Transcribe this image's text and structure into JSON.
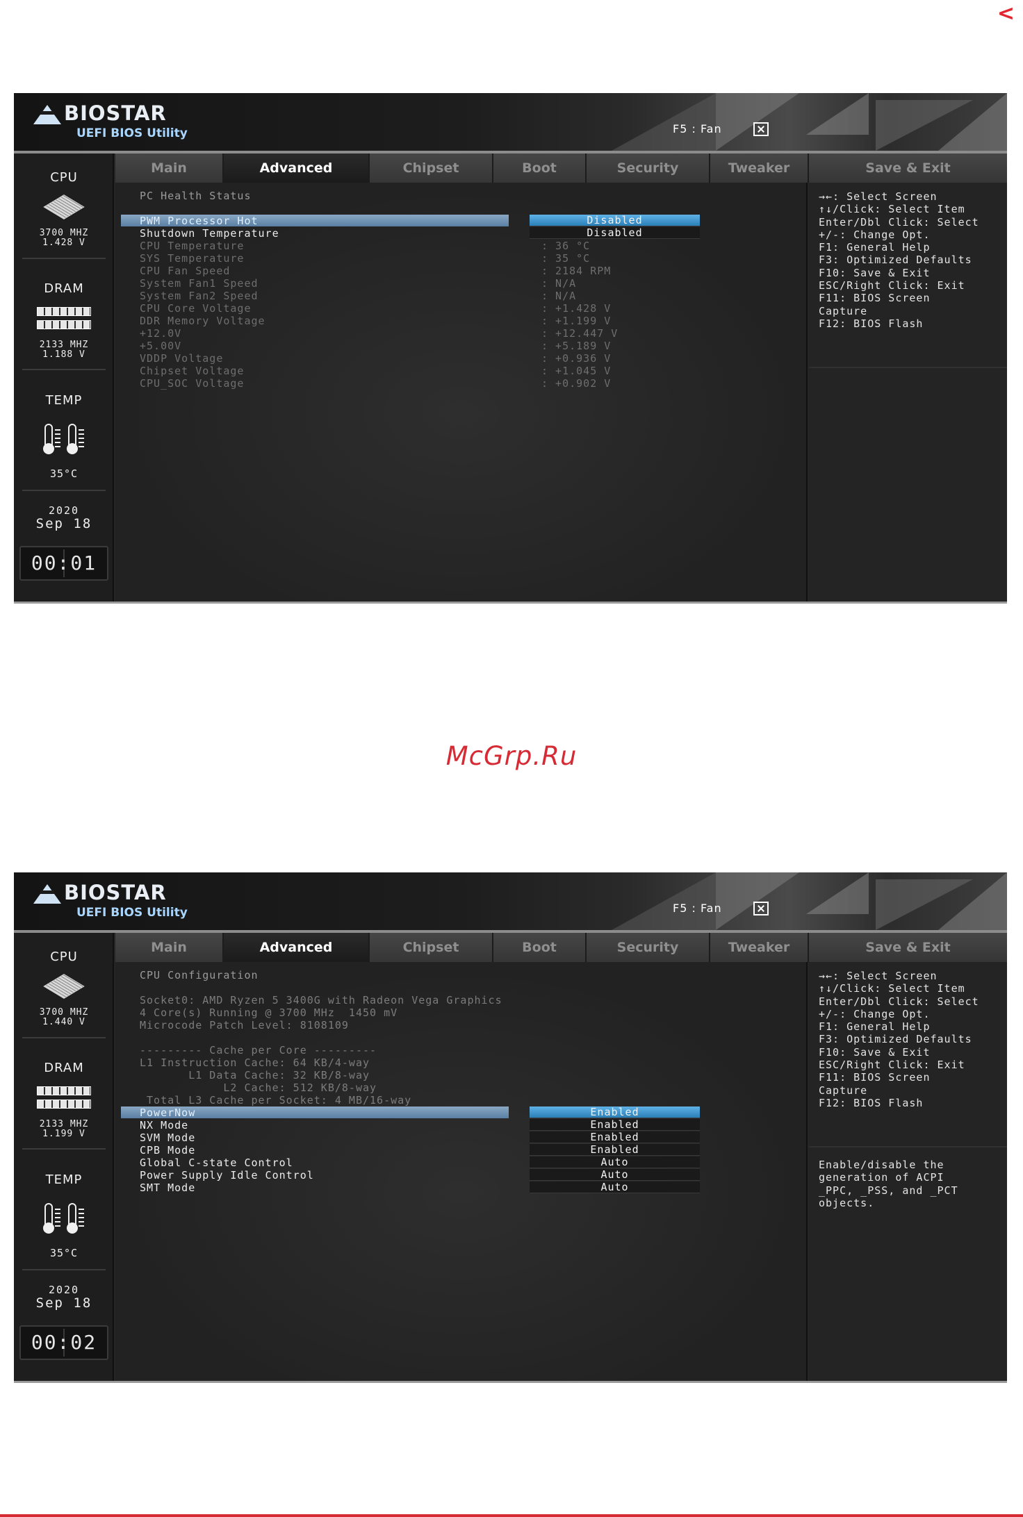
{
  "page": {
    "corner_arrow": "<",
    "watermark": "McGrp.Ru"
  },
  "common": {
    "logo_text": "BIOSTAR",
    "logo_sub": "UEFI BIOS Utility",
    "f5_fan": "F5 : Fan",
    "sidebar_titles": {
      "cpu": "CPU",
      "dram": "DRAM",
      "temp": "TEMP"
    },
    "tabs": [
      "Main",
      "Advanced",
      "Chipset",
      "Boot",
      "Security",
      "Tweaker",
      "Save & Exit"
    ],
    "active_tab": "Advanced",
    "help_keys": "→←: Select Screen\n↑↓/Click: Select Item\nEnter/Dbl Click: Select\n+/-: Change Opt.\nF1: General Help\nF3: Optimized Defaults\nF10: Save & Exit\nESC/Right Click: Exit\nF11: BIOS Screen\nCapture\nF12: BIOS Flash"
  },
  "screens": [
    {
      "sidebar": {
        "cpu_freq": "3700 MHZ",
        "cpu_volt": "1.428 V",
        "dram_freq": "2133 MHZ",
        "dram_volt": "1.188 V",
        "temp": "35°C",
        "year": "2020",
        "date": "Sep 18",
        "clock": "00:01"
      },
      "title": "PC Health Status",
      "options": [
        {
          "label": "PWM Processor Hot",
          "value": "Disabled"
        },
        {
          "label": "Shutdown Temperature",
          "value": "Disabled"
        }
      ],
      "readings": [
        {
          "label": "CPU Temperature",
          "value": ": 36 °C"
        },
        {
          "label": "SYS Temperature",
          "value": ": 35 °C"
        },
        {
          "label": "CPU Fan Speed",
          "value": ": 2184 RPM"
        },
        {
          "label": "System Fan1 Speed",
          "value": ": N/A"
        },
        {
          "label": "System Fan2 Speed",
          "value": ": N/A"
        },
        {
          "label": "CPU Core Voltage",
          "value": ": +1.428 V"
        },
        {
          "label": "DDR Memory Voltage",
          "value": ": +1.199 V"
        },
        {
          "label": "+12.0V",
          "value": ": +12.447 V"
        },
        {
          "label": "+5.00V",
          "value": ": +5.189 V"
        },
        {
          "label": "VDDP Voltage",
          "value": ": +0.936 V"
        },
        {
          "label": "Chipset Voltage",
          "value": ": +1.045 V"
        },
        {
          "label": "CPU_SOC Voltage",
          "value": ": +0.902 V"
        }
      ]
    },
    {
      "sidebar": {
        "cpu_freq": "3700 MHZ",
        "cpu_volt": "1.440 V",
        "dram_freq": "2133 MHZ",
        "dram_volt": "1.199 V",
        "temp": "35°C",
        "year": "2020",
        "date": "Sep 18",
        "clock": "00:02"
      },
      "title": "CPU Configuration",
      "info_lines": [
        "Socket0: AMD Ryzen 5 3400G with Radeon Vega Graphics",
        "4 Core(s) Running @ 3700 MHz  1450 mV",
        "Microcode Patch Level: 8108109",
        "",
        "--------- Cache per Core ---------",
        "L1 Instruction Cache: 64 KB/4-way",
        "       L1 Data Cache: 32 KB/8-way",
        "            L2 Cache: 512 KB/8-way",
        " Total L3 Cache per Socket: 4 MB/16-way"
      ],
      "options": [
        {
          "label": "PowerNow",
          "value": "Enabled"
        },
        {
          "label": "NX Mode",
          "value": "Enabled"
        },
        {
          "label": "SVM Mode",
          "value": "Enabled"
        },
        {
          "label": "CPB Mode",
          "value": "Enabled"
        },
        {
          "label": "Global C-state Control",
          "value": "Auto"
        },
        {
          "label": "Power Supply Idle Control",
          "value": "Auto"
        },
        {
          "label": "SMT Mode",
          "value": "Auto"
        }
      ],
      "help_description": "Enable/disable the\ngeneration of ACPI\n_PPC, _PSS, and _PCT\nobjects."
    }
  ]
}
